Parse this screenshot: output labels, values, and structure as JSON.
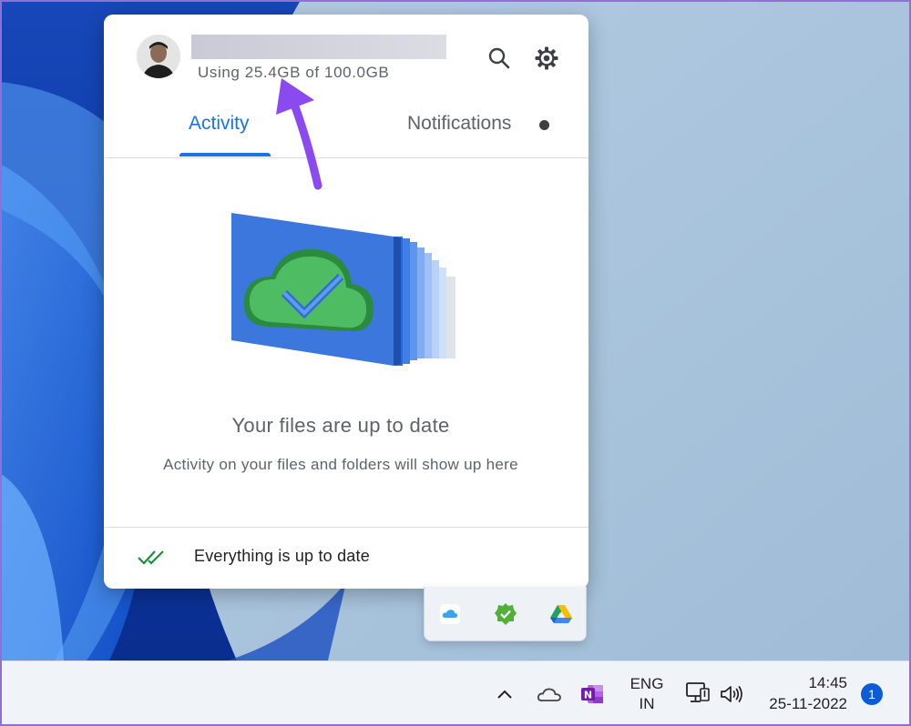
{
  "popup": {
    "storage_usage": "Using 25.4GB of 100.0GB",
    "tabs": [
      {
        "label": "Activity",
        "selected": true
      },
      {
        "label": "Notifications",
        "selected": false
      }
    ],
    "empty_state": {
      "title": "Your files are up to date",
      "subtitle": "Activity on your files and folders will show up here"
    },
    "status": "Everything is up to date",
    "icons": {
      "search": "search-icon",
      "settings": "gear-icon",
      "status": "double-check-icon"
    }
  },
  "tray_overflow": {
    "icons": [
      "icloud-icon",
      "sync-check-icon",
      "google-drive-icon"
    ]
  },
  "taskbar": {
    "language_line1": "ENG",
    "language_line2": "IN",
    "time": "14:45",
    "date": "25-11-2022",
    "notification_count": "1",
    "icons": [
      "chevron-up-icon",
      "onedrive-cloud-icon",
      "onenote-icon",
      "network-icon",
      "volume-icon"
    ]
  },
  "colors": {
    "accent": "#1a73e8",
    "annotation_arrow": "#8b49f0",
    "badge": "#0b5cd5"
  }
}
